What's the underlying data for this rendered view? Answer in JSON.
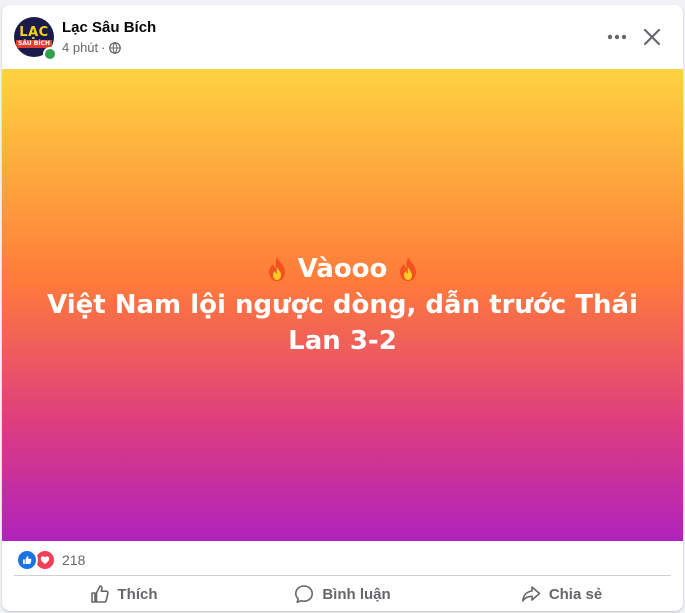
{
  "post": {
    "author": "Lạc Sâu Bích",
    "avatar_text_top": "LẠC",
    "avatar_text_bottom": "SÂU BÍCH",
    "time": "4 phút",
    "separator": "·",
    "privacy_icon": "globe-icon",
    "text_line1": "Vàooo",
    "text_line2": "Việt Nam lội ngược dòng, dẫn trước Thái Lan 3-2",
    "background_gradient": [
      "#fed340",
      "#ff7b3a",
      "#dd3d7f",
      "#b022bd"
    ]
  },
  "reactions": {
    "types": [
      "like-icon",
      "love-icon"
    ],
    "count": "218"
  },
  "actions": {
    "like": "Thích",
    "comment": "Bình luận",
    "share": "Chia sẻ"
  },
  "colors": {
    "text_primary": "#050505",
    "text_secondary": "#65676b",
    "like_blue": "#1b74e4",
    "love_red": "#f33e58",
    "online_green": "#31a24c"
  }
}
